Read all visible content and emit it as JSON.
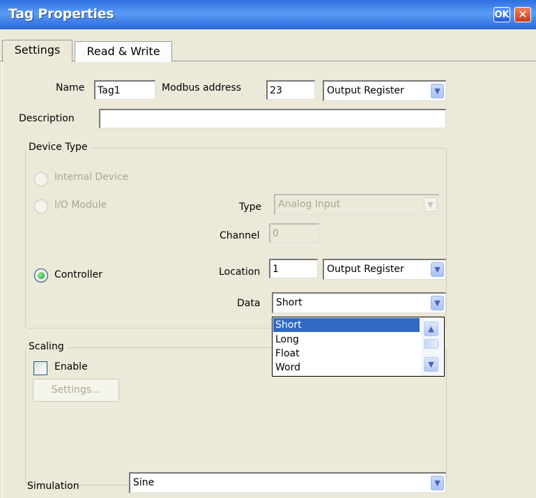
{
  "window": {
    "title": "Tag Properties",
    "ok_label": "OK",
    "close_label": "✕"
  },
  "tabs": [
    {
      "label": "Settings",
      "active": true
    },
    {
      "label": "Read & Write",
      "active": false
    }
  ],
  "fields": {
    "name_label": "Name",
    "name_value": "Tag1",
    "modbus_label": "Modbus address",
    "modbus_value": "23",
    "register_value": "Output Register",
    "description_label": "Description",
    "description_value": ""
  },
  "device_type": {
    "legend": "Device Type",
    "internal_device_label": "Internal Device",
    "io_module_label": "I/O Module",
    "controller_label": "Controller",
    "selected": "Controller",
    "type_label": "Type",
    "type_value": "Analog Input",
    "channel_label": "Channel",
    "channel_value": "0",
    "location_label": "Location",
    "location_value": "1",
    "location_register_value": "Output Register",
    "data_label": "Data",
    "data_value": "Short",
    "data_options": [
      "Short",
      "Long",
      "Float",
      "Word"
    ],
    "data_highlighted": "Short"
  },
  "scaling": {
    "legend": "Scaling",
    "enable_label": "Enable",
    "enable_checked": false,
    "settings_button": "Settings..."
  },
  "simulation": {
    "label": "Simulation",
    "value": "Sine"
  },
  "icons": {
    "dropdown": "▼",
    "scroll_up": "▲",
    "scroll_down": "▼"
  },
  "colors": {
    "titlebar": "#2a68d8",
    "selection": "#316ac5",
    "dialog_bg": "#ece9d8"
  }
}
